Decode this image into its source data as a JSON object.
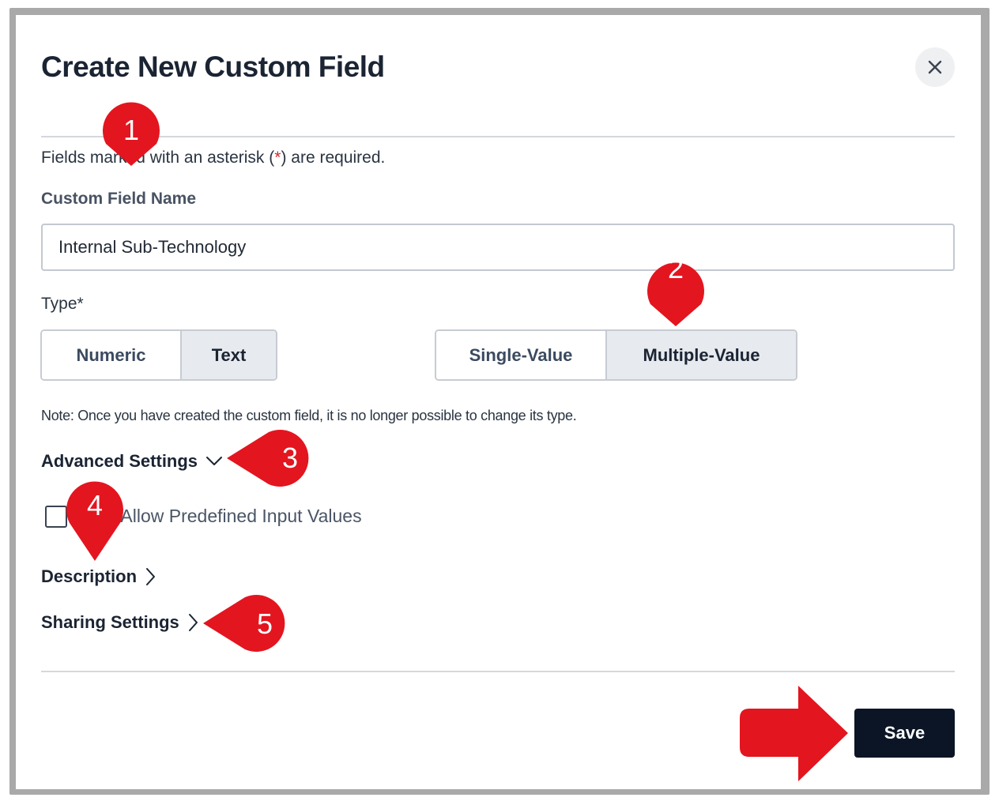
{
  "dialog": {
    "title": "Create New Custom Field",
    "close_icon": "close-icon"
  },
  "required_note": {
    "prefix": "Fields marked with an asterisk (",
    "star": "*",
    "suffix": ") are required."
  },
  "name_field": {
    "label": "Custom Field Name",
    "value": "Internal Sub-Technology"
  },
  "type": {
    "label": "Type*",
    "numeric_label": "Numeric",
    "text_label": "Text",
    "selected_format": "Text",
    "single_label": "Single-Value",
    "multiple_label": "Multiple-Value",
    "selected_cardinality": "Multiple-Value",
    "note": "Note: Once you have created the custom field, it is no longer possible to change its type."
  },
  "advanced": {
    "label": "Advanced Settings",
    "icon": "chevron-down-icon",
    "checkbox_label": "Only Allow Predefined Input Values",
    "checked": false
  },
  "description": {
    "label": "Description",
    "icon": "chevron-right-icon"
  },
  "sharing": {
    "label": "Sharing Settings",
    "icon": "chevron-right-icon"
  },
  "footer": {
    "save_label": "Save"
  },
  "annotations": {
    "markers": [
      "1",
      "2",
      "3",
      "4",
      "5"
    ],
    "color": "#e3151f"
  },
  "colors": {
    "primary_button": "#0c1526",
    "required_star": "#d7262e",
    "selected_segment": "#e7eaee"
  }
}
